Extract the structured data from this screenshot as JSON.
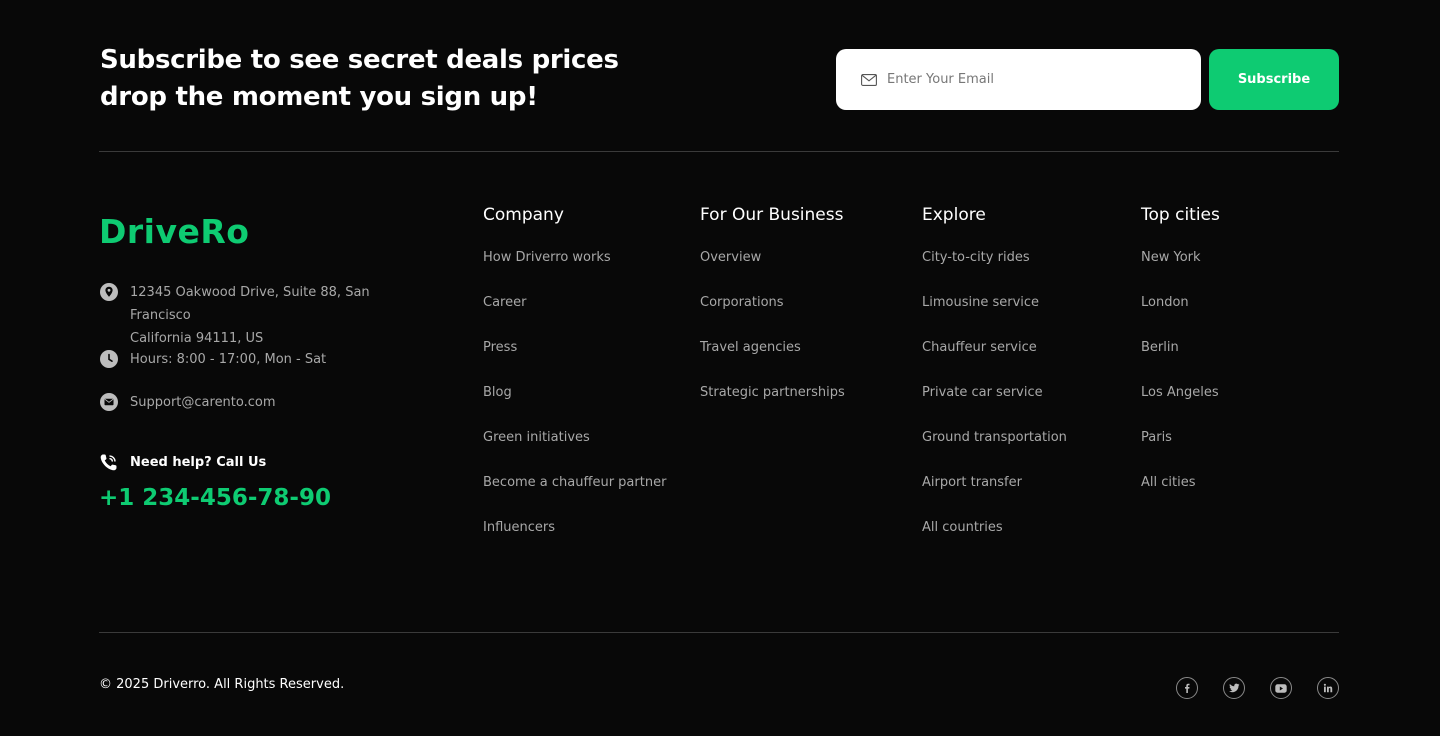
{
  "subscribe": {
    "heading_line1": "Subscribe to see secret deals prices",
    "heading_line2": "drop the moment you sign up!",
    "email_placeholder": "Enter Your Email",
    "button_label": "Subscribe"
  },
  "brand": {
    "logo_text": "DriveRo",
    "accent_color": "#0ecb72"
  },
  "contact": {
    "address_line1": "12345 Oakwood Drive, Suite 88, San Francisco",
    "address_line2": "California 94111, US",
    "hours": "Hours: 8:00 - 17:00, Mon - Sat",
    "email": "Support@carento.com",
    "help_label": "Need help? Call Us",
    "phone": "+1 234-456-78-90"
  },
  "columns": [
    {
      "title": "Company",
      "links": [
        "How Driverro works",
        "Career",
        "Press",
        "Blog",
        "Green initiatives",
        "Become a chauffeur partner",
        "Influencers"
      ]
    },
    {
      "title": "For Our Business",
      "links": [
        "Overview",
        "Corporations",
        "Travel agencies",
        "Strategic partnerships"
      ]
    },
    {
      "title": "Explore",
      "links": [
        "City-to-city rides",
        "Limousine service",
        "Chauffeur service",
        "Private car service",
        "Ground transportation",
        "Airport transfer",
        "All countries"
      ]
    },
    {
      "title": "Top cities",
      "links": [
        "New York",
        "London",
        "Berlin",
        "Los Angeles",
        "Paris",
        "All cities"
      ]
    }
  ],
  "footer": {
    "copyright": "© 2025 Driverro. All Rights Reserved.",
    "socials": [
      "facebook-icon",
      "twitter-icon",
      "youtube-icon",
      "linkedin-icon"
    ]
  }
}
